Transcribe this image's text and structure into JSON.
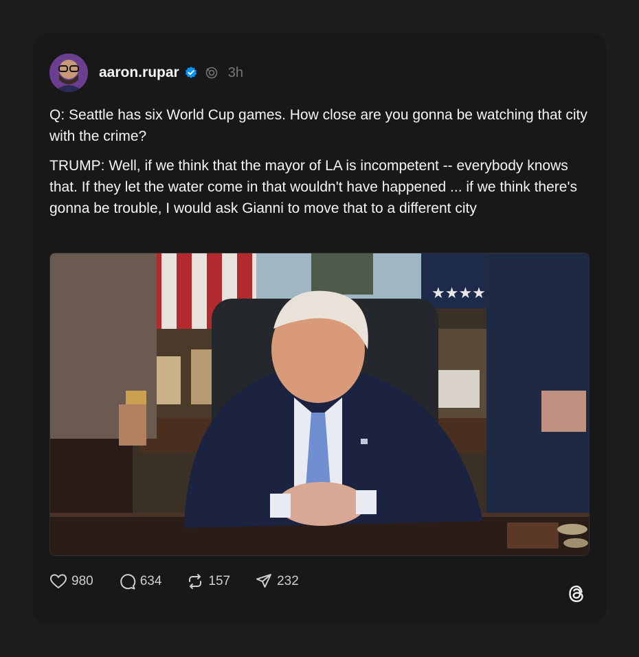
{
  "post": {
    "author": {
      "username": "aaron.rupar",
      "verified": true,
      "avatar_icon": "avatar-photo"
    },
    "time": "3h",
    "paragraphs": [
      "Q: Seattle has six World Cup games. How close are you gonna be watching that city with the crime?",
      "TRUMP: Well, if we think that the mayor of LA is incompetent -- everybody knows that. If they let the water come in that wouldn't have happened ... if we think there's gonna be trouble, I would ask Gianni to move that to a different city"
    ],
    "media": {
      "type": "video-still",
      "icon": "video-frame"
    },
    "actions": {
      "likes": "980",
      "replies": "634",
      "reposts": "157",
      "shares": "232"
    }
  },
  "colors": {
    "page_bg": "#1c1c1c",
    "card_bg": "#181818",
    "text": "#f3f5f7",
    "muted": "#777777",
    "verified_blue": "#0095f6"
  },
  "icons": [
    "verified-badge-icon",
    "repost-indicator-icon",
    "heart-icon",
    "comment-icon",
    "repost-icon",
    "share-icon",
    "threads-logo-icon"
  ]
}
